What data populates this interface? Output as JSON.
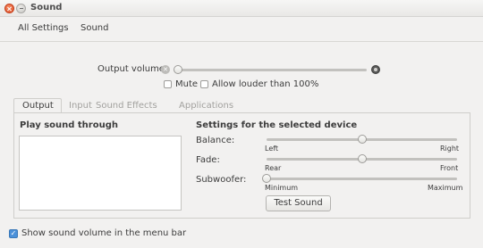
{
  "window": {
    "title": "Sound"
  },
  "toolbar": {
    "all_settings": "All Settings",
    "sound": "Sound"
  },
  "volume": {
    "label": "Output volume:",
    "mute_icon": "speaker-muted-icon",
    "max_icon": "speaker-high-icon",
    "level": 0.0,
    "mute_label": "Mute",
    "mute_checked": false,
    "allow_louder_label": "Allow louder than 100%",
    "allow_louder_checked": false
  },
  "tabs": [
    {
      "label": "Output",
      "active": true
    },
    {
      "label": "Input",
      "active": false
    },
    {
      "label": "Sound Effects",
      "active": false
    },
    {
      "label": "Applications",
      "active": false
    }
  ],
  "output": {
    "play_through_heading": "Play sound through",
    "devices": [],
    "settings_heading": "Settings for the selected device",
    "balance": {
      "label": "Balance:",
      "min_label": "Left",
      "max_label": "Right",
      "value": 0.5
    },
    "fade": {
      "label": "Fade:",
      "min_label": "Rear",
      "max_label": "Front",
      "value": 0.5
    },
    "subwoofer": {
      "label": "Subwoofer:",
      "min_label": "Minimum",
      "max_label": "Maximum",
      "value": 0.0
    },
    "test_button": "Test Sound"
  },
  "footer": {
    "menubar_label": "Show sound volume in the menu bar",
    "menubar_checked": true
  },
  "colors": {
    "window_bg": "#f2f1f0",
    "close_button": "#e0502a",
    "checkbox_accent": "#4a90d9"
  }
}
